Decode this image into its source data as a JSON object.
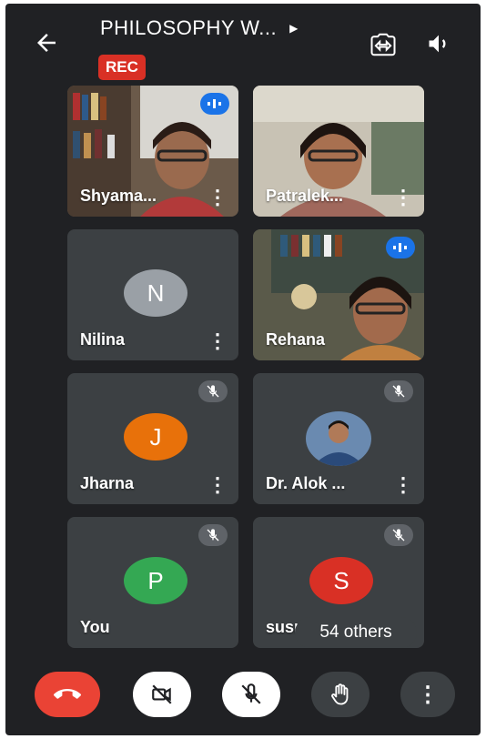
{
  "meeting": {
    "title": "PHILOSOPHY W...",
    "rec_label": "REC"
  },
  "participants": [
    {
      "name": "Shyama...",
      "type": "video",
      "speaking": true
    },
    {
      "name": "Patralek...",
      "type": "video",
      "speaking": false
    },
    {
      "name": "Nilina",
      "type": "avatar",
      "initial": "N",
      "color": "#9aa0a6"
    },
    {
      "name": "Rehana",
      "type": "video",
      "speaking": true
    },
    {
      "name": "Jharna",
      "type": "avatar",
      "initial": "J",
      "color": "#e8710a",
      "muted": true
    },
    {
      "name": "Dr. Alok ...",
      "type": "photo-avatar",
      "muted": true
    },
    {
      "name": "You",
      "type": "avatar",
      "initial": "P",
      "color": "#34a853",
      "muted": true
    },
    {
      "name": "susmita",
      "type": "avatar",
      "initial": "S",
      "color": "#d93025",
      "muted": true
    }
  ],
  "others_label": "54 others",
  "colors": {
    "background": "#202124",
    "tile": "#3c4043",
    "end_call": "#ea4335",
    "rec": "#d93025",
    "speaking": "#1a73e8"
  },
  "icons": [
    "back-arrow-icon",
    "switch-camera-icon",
    "speaker-icon",
    "more-vert-icon",
    "mic-off-icon",
    "camera-off-icon",
    "hand-raise-icon",
    "end-call-icon",
    "audio-level-icon"
  ]
}
